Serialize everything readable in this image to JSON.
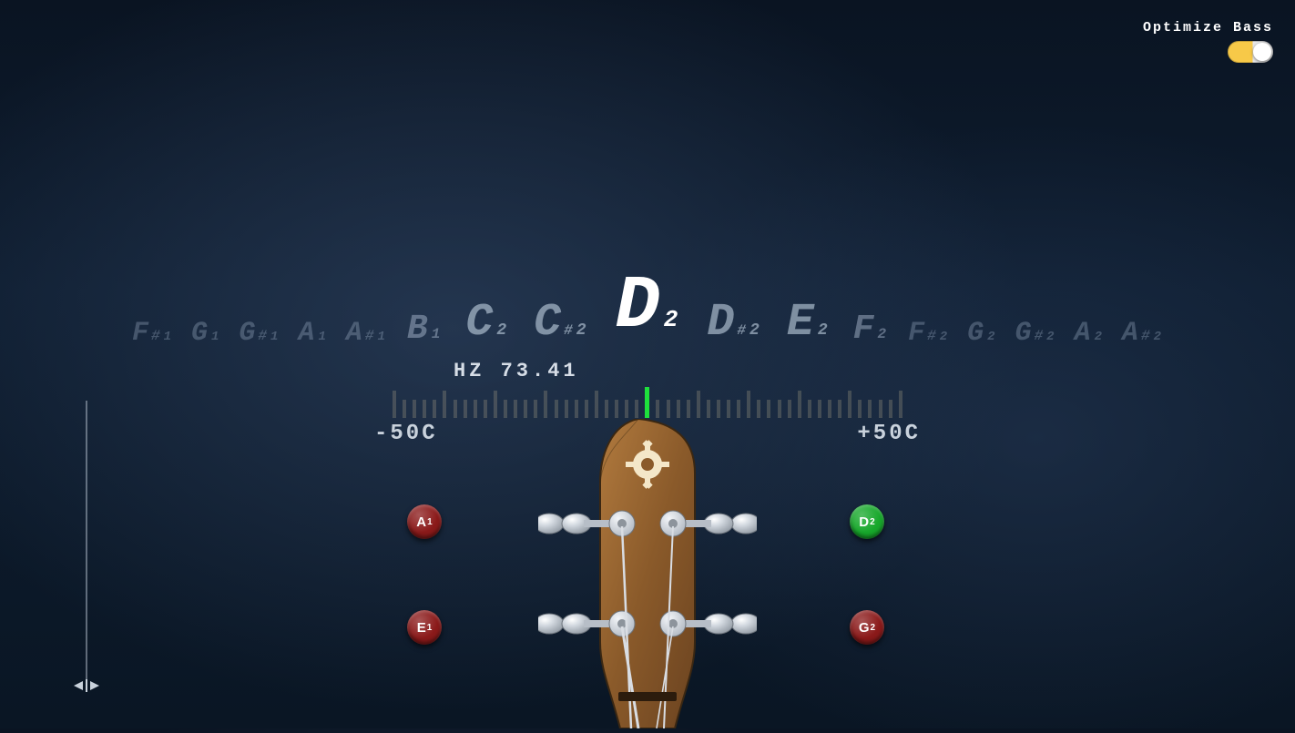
{
  "optimize": {
    "label": "Optimize Bass",
    "on": true
  },
  "notes": [
    {
      "n": "F",
      "sharp": true,
      "oct": "1",
      "size": 1
    },
    {
      "n": "G",
      "sharp": false,
      "oct": "1",
      "size": 1
    },
    {
      "n": "G",
      "sharp": true,
      "oct": "1",
      "size": 1
    },
    {
      "n": "A",
      "sharp": false,
      "oct": "1",
      "size": 1
    },
    {
      "n": "A",
      "sharp": true,
      "oct": "1",
      "size": 1
    },
    {
      "n": "B",
      "sharp": false,
      "oct": "1",
      "size": 2
    },
    {
      "n": "C",
      "sharp": false,
      "oct": "2",
      "size": 3
    },
    {
      "n": "C",
      "sharp": true,
      "oct": "2",
      "size": 3
    },
    {
      "n": "D",
      "sharp": false,
      "oct": "2",
      "size": 4
    },
    {
      "n": "D",
      "sharp": true,
      "oct": "2",
      "size": 3
    },
    {
      "n": "E",
      "sharp": false,
      "oct": "2",
      "size": 3
    },
    {
      "n": "F",
      "sharp": false,
      "oct": "2",
      "size": 2
    },
    {
      "n": "F",
      "sharp": true,
      "oct": "2",
      "size": 1
    },
    {
      "n": "G",
      "sharp": false,
      "oct": "2",
      "size": 1
    },
    {
      "n": "G",
      "sharp": true,
      "oct": "2",
      "size": 1
    },
    {
      "n": "A",
      "sharp": false,
      "oct": "2",
      "size": 1
    },
    {
      "n": "A",
      "sharp": true,
      "oct": "2",
      "size": 1
    }
  ],
  "hz": {
    "label": "HZ",
    "value": "73.41"
  },
  "cents": {
    "ticks": 51,
    "center": 25,
    "leftLabel": "-50C",
    "rightLabel": "+50C"
  },
  "strings": {
    "A": {
      "note": "A",
      "oct": "1",
      "tuned": false
    },
    "D": {
      "note": "D",
      "oct": "2",
      "tuned": true
    },
    "E": {
      "note": "E",
      "oct": "1",
      "tuned": false
    },
    "G": {
      "note": "G",
      "oct": "2",
      "tuned": false
    }
  },
  "colors": {
    "tuned": "#17a82b",
    "untuned": "#8b1a1a",
    "indicator": "#1ee03c",
    "toggle": "#f7c948"
  }
}
